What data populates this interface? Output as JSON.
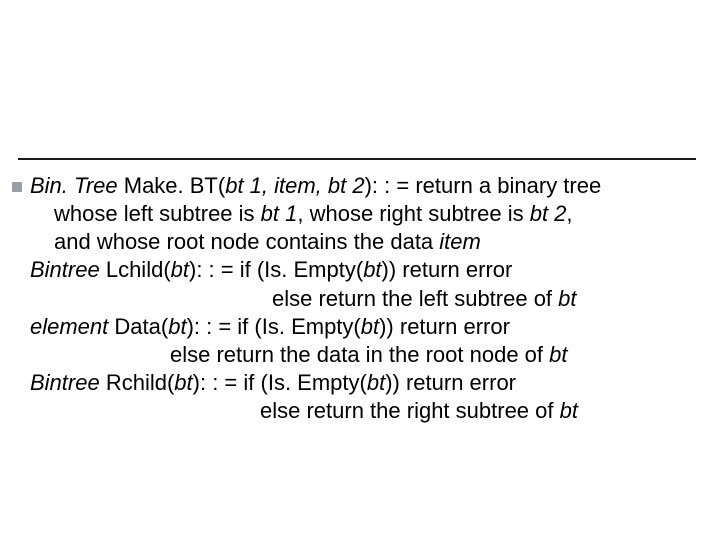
{
  "makebt": {
    "type": "Bin. Tree",
    "fn": " Make. BT(",
    "args": "bt 1,  item,  bt 2",
    "after_args": "): : = return a binary tree",
    "l2a": "whose left subtree is ",
    "l2b": "bt 1",
    "l2c": ", whose right subtree is ",
    "l2d": "bt 2",
    "l2e": ",",
    "l3a": "and whose root node contains the data ",
    "l3b": "item"
  },
  "lchild": {
    "type": "Bintree",
    "fn": " Lchild(",
    "arg": "bt",
    "after": "): : = if (Is. Empty(",
    "arg2": "bt",
    "tail": ")) return error",
    "else_a": "else return the left subtree of ",
    "else_b": "bt"
  },
  "datafn": {
    "type": "element",
    "fn": " Data(",
    "arg": "bt",
    "after": "): : = if (Is. Empty(",
    "arg2": "bt",
    "tail": ")) return error",
    "else_a": "else return the data in the root node of ",
    "else_b": "bt"
  },
  "rchild": {
    "type": "Bintree",
    "fn": " Rchild(",
    "arg": "bt",
    "after": "): : = if (Is. Empty(",
    "arg2": "bt",
    "tail": ")) return error",
    "else_a": "else return the right subtree of ",
    "else_b": "bt"
  }
}
